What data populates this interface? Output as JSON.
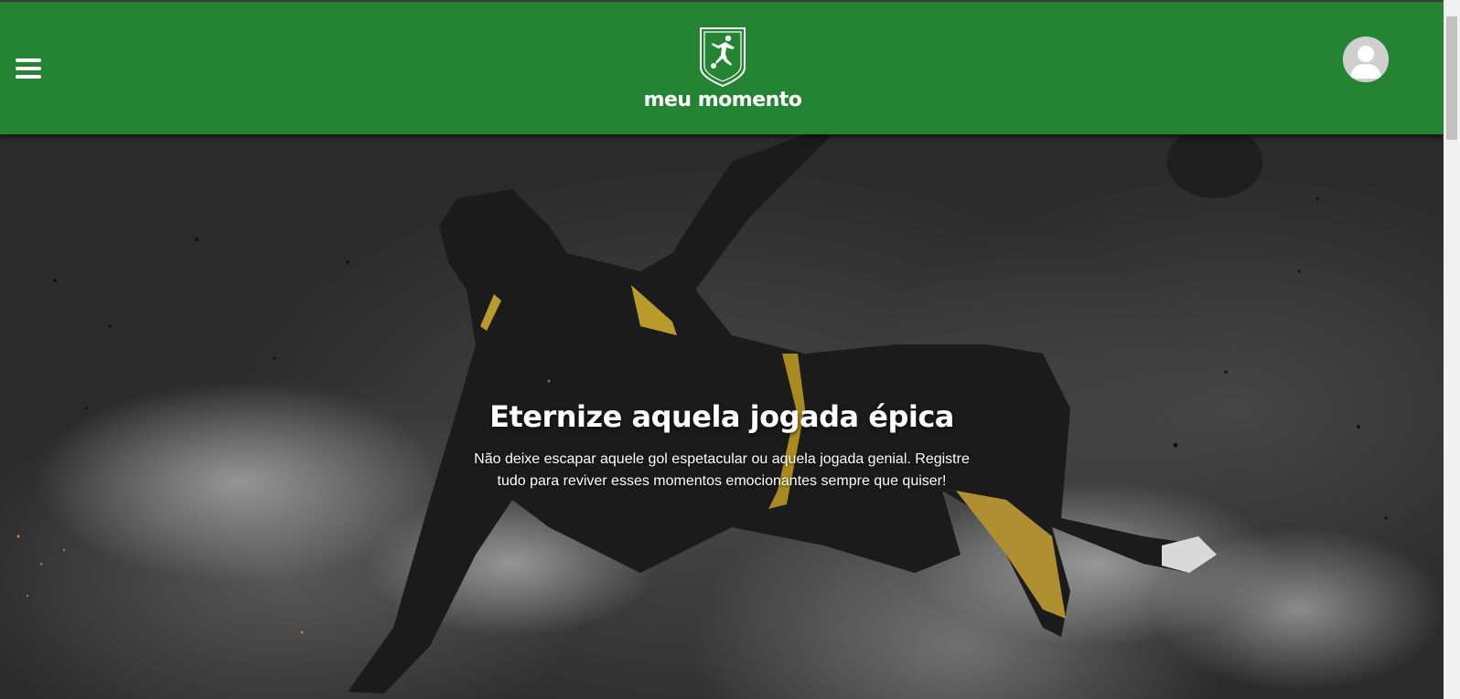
{
  "header": {
    "brand_name": "Meu momento",
    "background_color": "#258434",
    "menu_icon": "hamburger-menu-icon",
    "logo_icon": "soccer-player-badge-icon",
    "profile_icon": "user-avatar-icon"
  },
  "hero": {
    "title": "Eternize aquela jogada épica",
    "description": "Não deixe escapar aquele gol espetacular ou aquela jogada genial. Registre tudo para reviver esses momentos emocionantes sempre que quiser!"
  }
}
